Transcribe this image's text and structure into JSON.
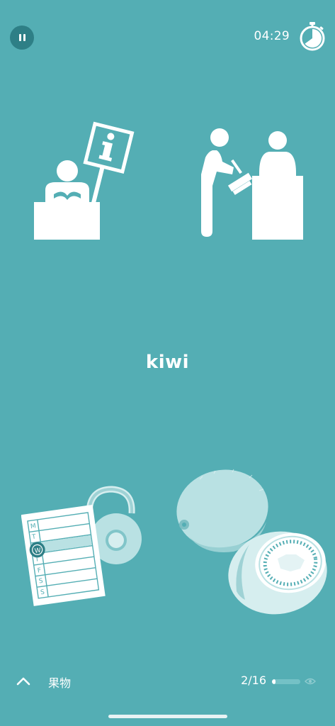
{
  "header": {
    "pause_icon": "pause-icon",
    "timer": "04:29",
    "stopwatch_icon": "stopwatch-icon"
  },
  "choices": [
    {
      "icon": "information-desk-illustration"
    },
    {
      "icon": "checkout-counter-illustration"
    },
    {
      "icon": "workout-schedule-kettlebell-illustration"
    },
    {
      "icon": "kiwi-fruit-illustration"
    }
  ],
  "word": "kiwi",
  "footer": {
    "expand_icon": "chevron-up-icon",
    "category": "果物",
    "progress": "2/16",
    "progress_fraction": 0.125,
    "visibility_icon": "eye-icon"
  },
  "colors": {
    "background": "#54aeb4",
    "pause_button": "#2e7f86",
    "foreground": "#ffffff",
    "illustration_light": "#b9e1e3"
  }
}
